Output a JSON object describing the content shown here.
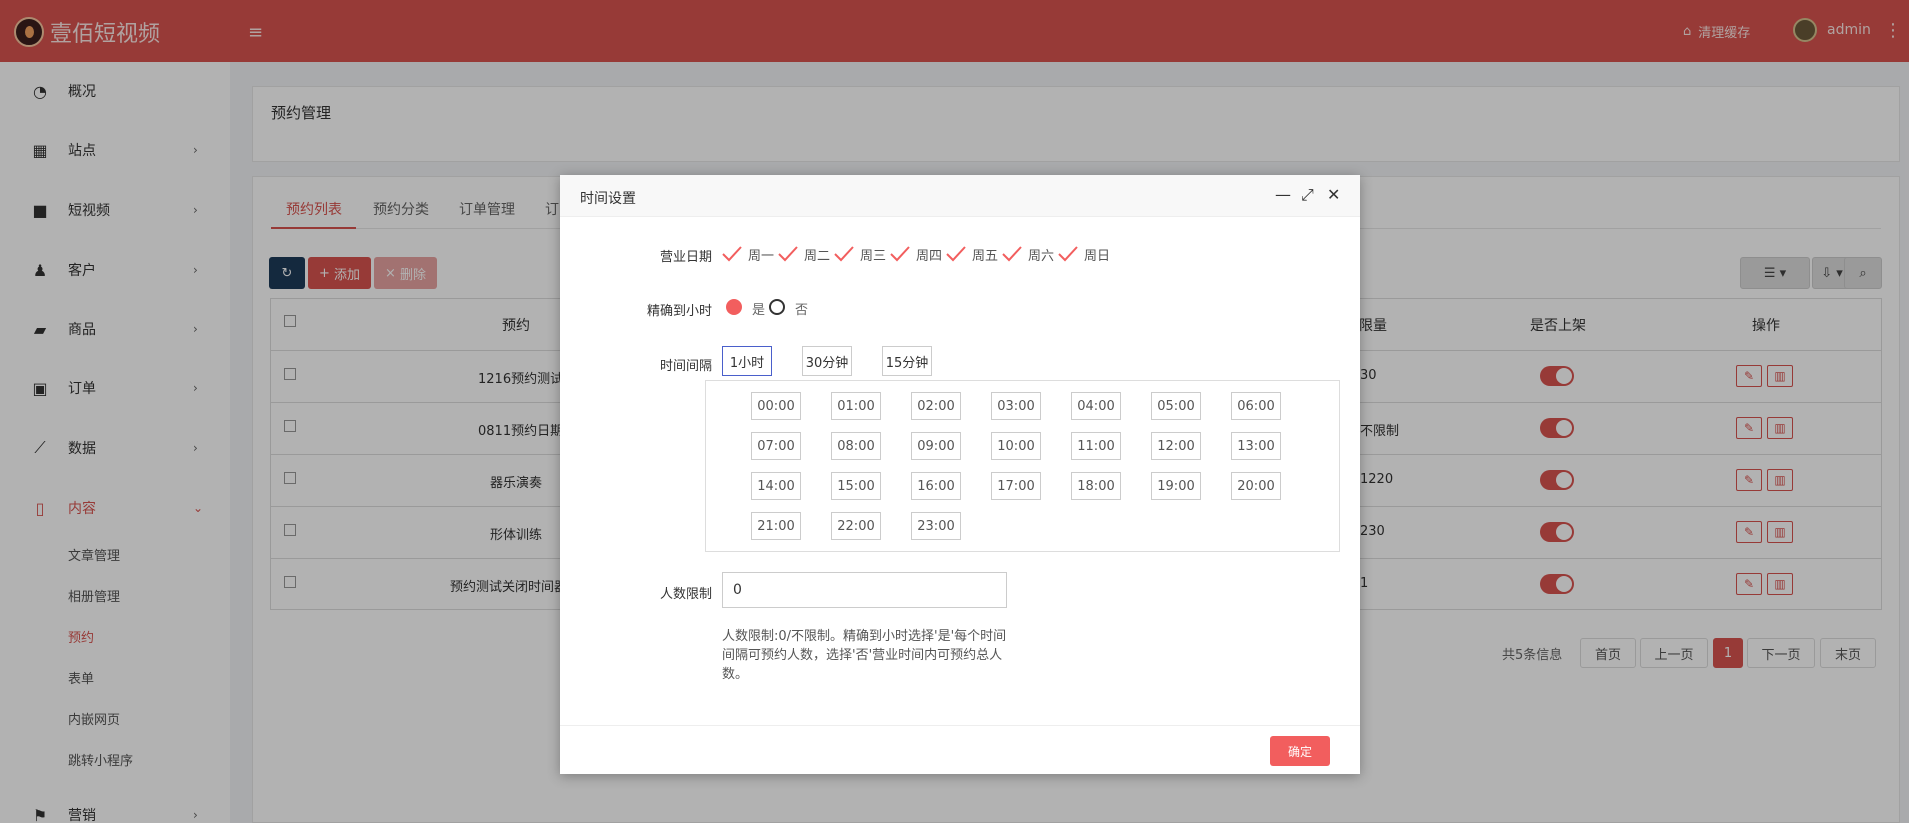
{
  "app": {
    "brand": "壹佰短视频",
    "clear_cache": "清理缓存",
    "user": "admin"
  },
  "sidebar": {
    "items": [
      {
        "label": "概况",
        "icon": "dashboard-icon",
        "glyph": "◔"
      },
      {
        "label": "站点",
        "icon": "grid-icon",
        "glyph": "▦"
      },
      {
        "label": "短视频",
        "icon": "video-camera-icon",
        "glyph": "■"
      },
      {
        "label": "客户",
        "icon": "users-icon",
        "glyph": "♟"
      },
      {
        "label": "商品",
        "icon": "cart-icon",
        "glyph": "▰"
      },
      {
        "label": "订单",
        "icon": "money-icon",
        "glyph": "▣"
      },
      {
        "label": "数据",
        "icon": "chart-icon",
        "glyph": "⟋"
      },
      {
        "label": "内容",
        "icon": "document-icon",
        "glyph": "▯"
      },
      {
        "label": "营销",
        "icon": "flag-icon",
        "glyph": "⚑"
      }
    ],
    "content_sub": [
      "文章管理",
      "相册管理",
      "预约",
      "表单",
      "内嵌网页",
      "跳转小程序"
    ]
  },
  "page": {
    "title": "预约管理",
    "tabs": [
      "预约列表",
      "预约分类",
      "订单管理",
      "订"
    ],
    "buttons": {
      "add": "添加",
      "delete": "删除"
    },
    "table": {
      "headers": [
        "预约",
        "限量",
        "是否上架",
        "操作"
      ],
      "rows": [
        {
          "name": "1216预约测试",
          "limit": "30"
        },
        {
          "name": "0811预约日期",
          "limit": "不限制"
        },
        {
          "name": "器乐演奏",
          "limit": "1220"
        },
        {
          "name": "形体训练",
          "limit": "230"
        },
        {
          "name": "预约测试关闭时间器",
          "limit": "1"
        }
      ]
    },
    "pager": {
      "info": "共5条信息",
      "first": "首页",
      "prev": "上一页",
      "current": "1",
      "next": "下一页",
      "last": "末页"
    }
  },
  "modal": {
    "title": "时间设置",
    "business_days_label": "营业日期",
    "days": [
      "周一",
      "周二",
      "周三",
      "周四",
      "周五",
      "周六",
      "周日"
    ],
    "hourly_label": "精确到小时",
    "yes": "是",
    "no": "否",
    "interval_label": "时间间隔",
    "intervals": [
      "1小时",
      "30分钟",
      "15分钟"
    ],
    "slots": [
      "00:00",
      "01:00",
      "02:00",
      "03:00",
      "04:00",
      "05:00",
      "06:00",
      "07:00",
      "08:00",
      "09:00",
      "10:00",
      "11:00",
      "12:00",
      "13:00",
      "14:00",
      "15:00",
      "16:00",
      "17:00",
      "18:00",
      "19:00",
      "20:00",
      "21:00",
      "22:00",
      "23:00"
    ],
    "people_label": "人数限制",
    "people_value": "0",
    "hint": "人数限制:0/不限制。精确到小时选择'是'每个时间间隔可预约人数，选择'否'营业时间内可预约总人数。",
    "confirm": "确定"
  },
  "colors": {
    "brand": "#d9534f",
    "confirm": "#f25e5e",
    "selected_interval": "#4a5fcb"
  }
}
